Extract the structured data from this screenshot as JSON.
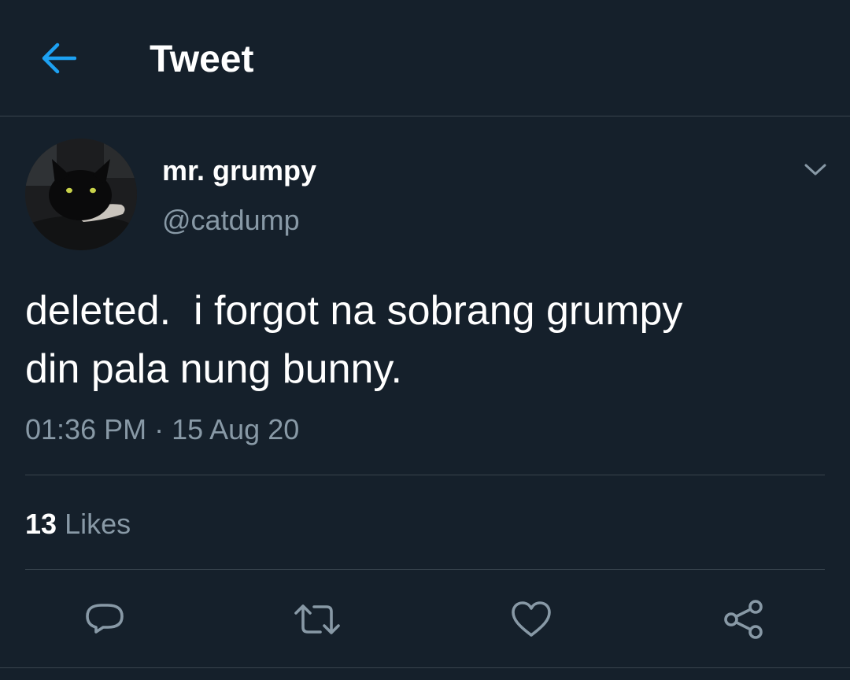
{
  "header": {
    "title": "Tweet",
    "back_icon": "arrow-left-icon",
    "accent_color": "#1da1f2"
  },
  "author": {
    "display_name": "mr. grumpy",
    "handle": "@catdump",
    "avatar": "black cat avatar"
  },
  "tweet": {
    "text": "deleted.  i forgot na sobrang grumpy\ndin pala nung bunny.",
    "timestamp": "01:36 PM · 15 Aug 20"
  },
  "stats": {
    "likes_count": "13",
    "likes_label": "Likes"
  },
  "actions": [
    {
      "name": "reply",
      "icon": "reply-icon"
    },
    {
      "name": "retweet",
      "icon": "retweet-icon"
    },
    {
      "name": "like",
      "icon": "heart-icon"
    },
    {
      "name": "share",
      "icon": "share-icon"
    }
  ],
  "colors": {
    "background": "#15202b",
    "text": "#ffffff",
    "secondary_text": "#8899a6",
    "divider": "#38444d",
    "accent": "#1da1f2"
  }
}
